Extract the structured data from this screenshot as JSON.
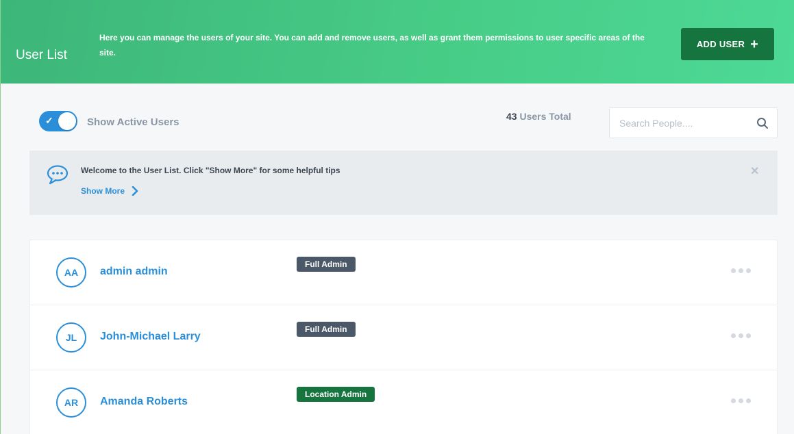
{
  "header": {
    "title": "User List",
    "description": "Here you can manage the users of your site. You can add and remove users, as well as grant them permissions to user specific areas of the site.",
    "add_user_label": "ADD USER",
    "background_color": "#47cc86"
  },
  "controls": {
    "toggle_label": "Show Active Users",
    "toggle_on": true,
    "users_total_count": "43",
    "users_total_suffix": " Users Total",
    "search_placeholder": "Search People...."
  },
  "tips": {
    "message": "Welcome to the User List. Click \"Show More\" for some helpful tips",
    "show_more_label": "Show More"
  },
  "users": [
    {
      "initials": "AA",
      "name": "admin admin",
      "role": "Full Admin",
      "role_color": "#4a5868"
    },
    {
      "initials": "JL",
      "name": "John-Michael Larry",
      "role": "Full Admin",
      "role_color": "#4a5868"
    },
    {
      "initials": "AR",
      "name": "Amanda Roberts",
      "role": "Location Admin",
      "role_color": "#16753f"
    }
  ],
  "colors": {
    "accent_blue": "#2a8fd8",
    "brand_green_dark": "#16753f",
    "badge_slate": "#4a5868"
  }
}
